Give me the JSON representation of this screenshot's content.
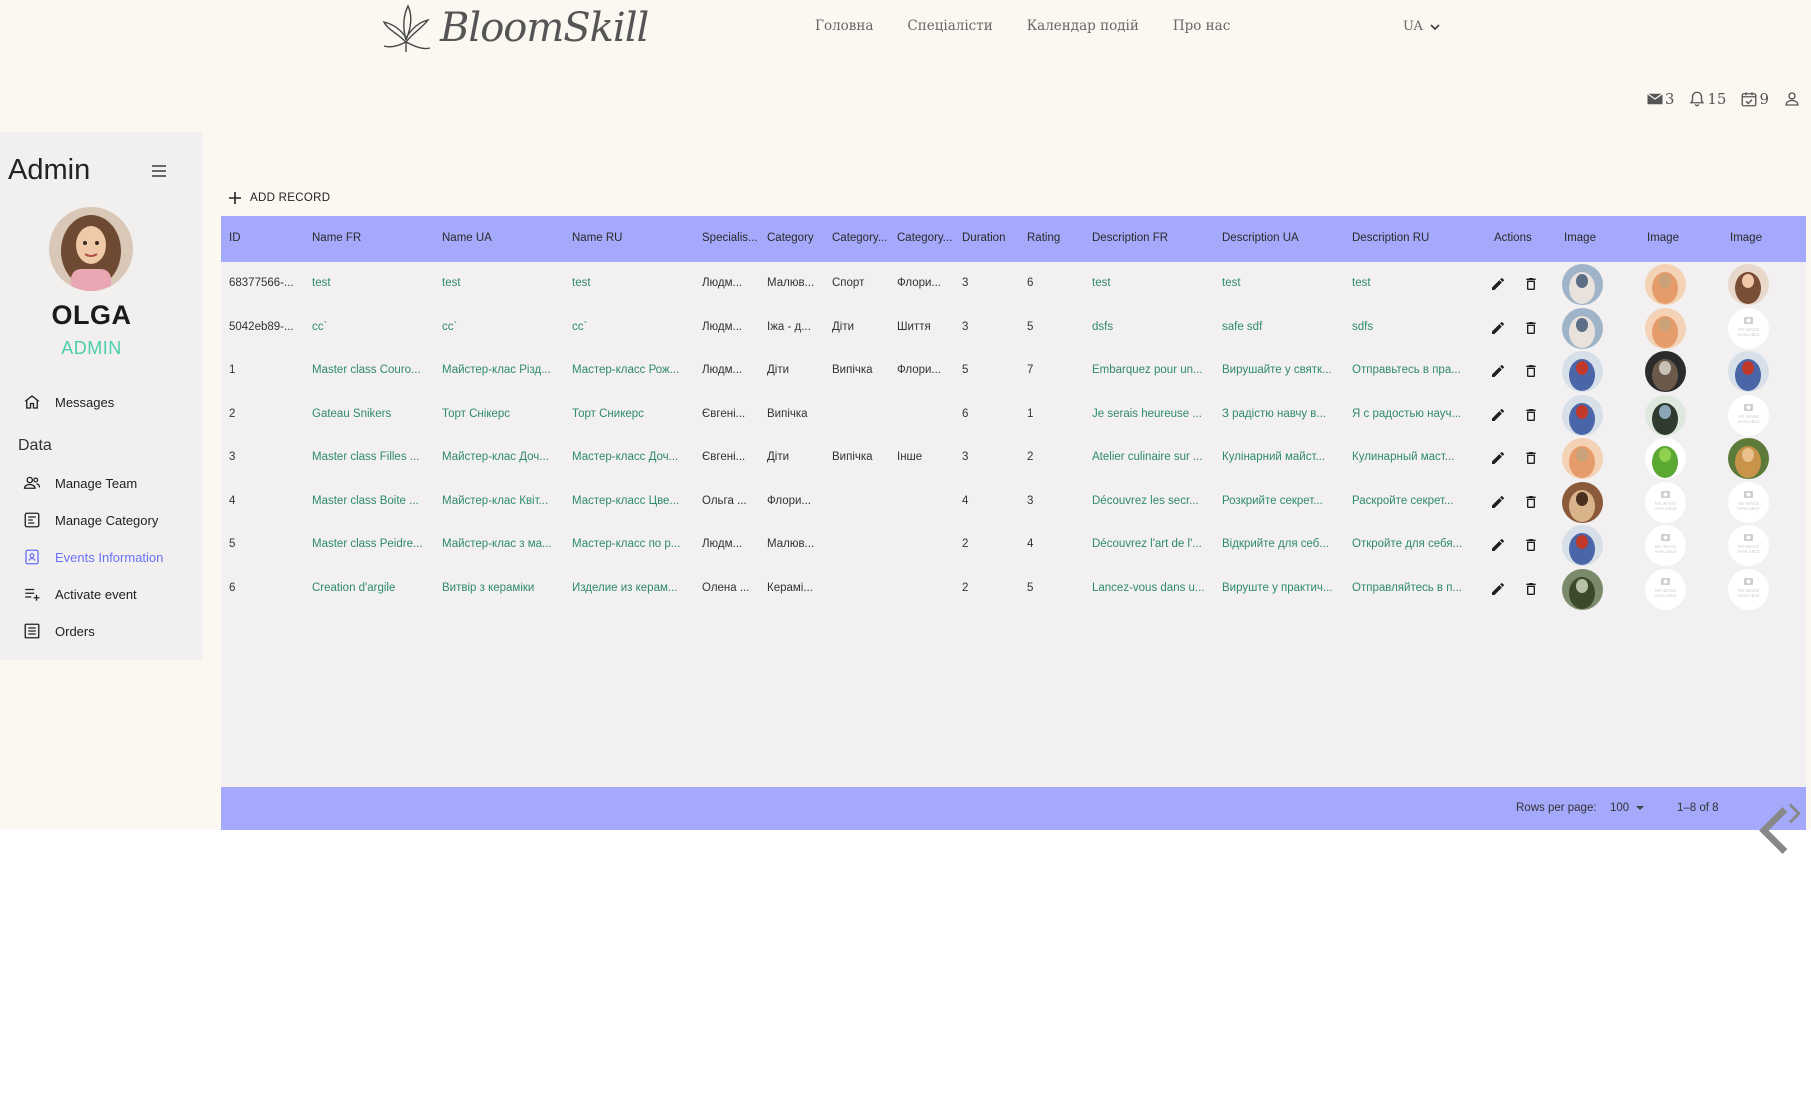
{
  "header": {
    "logo_text": "BloomSkill",
    "nav": [
      "Головна",
      "Спеціалісти",
      "Календар подій",
      "Про нас"
    ],
    "lang": "UA",
    "counts": {
      "mail": "3",
      "notifications": "15",
      "events": "9"
    }
  },
  "sidebar": {
    "title": "Admin",
    "user_name": "OLGA",
    "user_role": "ADMIN",
    "messages": "Messages",
    "section": "Data",
    "items": [
      "Manage Team",
      "Manage Category",
      "Events Information",
      "Activate event",
      "Orders"
    ],
    "active_item": "Events Information"
  },
  "toolbar": {
    "add_record": "ADD RECORD"
  },
  "table": {
    "columns": [
      "ID",
      "Name FR",
      "Name UA",
      "Name RU",
      "Specialis...",
      "Category",
      "Category...",
      "Category...",
      "Duration",
      "Rating",
      "Description FR",
      "Description UA",
      "Description RU",
      "Actions",
      "Image",
      "Image",
      "Image"
    ],
    "rows": [
      [
        "68377566-...",
        "test",
        "test",
        "test",
        "Людм...",
        "Малюв...",
        "Спорт",
        "Флори...",
        "3",
        "6",
        "test",
        "test",
        "test"
      ],
      [
        "5042eb89-...",
        "cc`",
        "cc`",
        "cc`",
        "Людм...",
        "Їжа - д...",
        "Діти",
        "Шиття",
        "3",
        "5",
        "dsfs",
        "safe sdf",
        "sdfs"
      ],
      [
        "1",
        "Master class Couro...",
        "Майстер-клас Різд...",
        "Мастер-класс Рож...",
        "Людм...",
        "Діти",
        "Випічка",
        "Флори...",
        "5",
        "7",
        "Embarquez pour un...",
        "Вирушайте у святк...",
        "Отправьтесь в пра..."
      ],
      [
        "2",
        "Gateau Snikers",
        "Торт Снікерс",
        "Торт Сникерс",
        "Євгені...",
        "Випічка",
        "",
        "",
        "6",
        "1",
        "Je serais heureuse ...",
        "З радістю навчу в...",
        "Я с радостью науч..."
      ],
      [
        "3",
        "Master class Filles ...",
        "Майстер-клас Доч...",
        "Мастер-класс Доч...",
        "Євгені...",
        "Діти",
        "Випічка",
        "Інше",
        "3",
        "2",
        "Atelier culinaire sur ...",
        "Кулінарний майст...",
        "Кулинарный маст..."
      ],
      [
        "4",
        "Master class Boite ...",
        "Майстер-клас Квіт...",
        "Мастер-класс Цве...",
        "Ольга ...",
        "Флори...",
        "",
        "",
        "4",
        "3",
        "Découvrez les secr...",
        "Розкрийте секрет...",
        "Раскройте секрет..."
      ],
      [
        "5",
        "Master class Peidre...",
        "Майстер-клас з ма...",
        "Мастер-класс по р...",
        "Людм...",
        "Малюв...",
        "",
        "",
        "2",
        "4",
        "Découvrez l'art de l'...",
        "Відкрийте для себ...",
        "Откройте для себя..."
      ],
      [
        "6",
        "Creation d'argile",
        "Витвір з кераміки",
        "Изделие из керам...",
        "Олена ...",
        "Керамі...",
        "",
        "",
        "2",
        "5",
        "Lancez-vous dans u...",
        "Вируште у практич...",
        "Отправляйтесь в п..."
      ]
    ],
    "images": [
      [
        "portrait-blue",
        "flowers-peach",
        "portrait-woman"
      ],
      [
        "portrait-blue",
        "flowers-peach",
        "no-image"
      ],
      [
        "stripes-blue-red",
        "cake-dark",
        "stripes-blue-red"
      ],
      [
        "stripes-blue-red",
        "person-green",
        "no-image"
      ],
      [
        "flowers-peach",
        "apple-green",
        "dog-golden"
      ],
      [
        "jars-brown",
        "no-image",
        "no-image"
      ],
      [
        "stripes-blue-red",
        "no-image",
        "no-image"
      ],
      [
        "plant-green",
        "no-image",
        "no-image"
      ]
    ],
    "no_image_text": "NO IMAGE AVAILABLE"
  },
  "footer": {
    "rows_per_page_label": "Rows per page:",
    "rows_per_page_value": "100",
    "range": "1–8 of 8"
  }
}
